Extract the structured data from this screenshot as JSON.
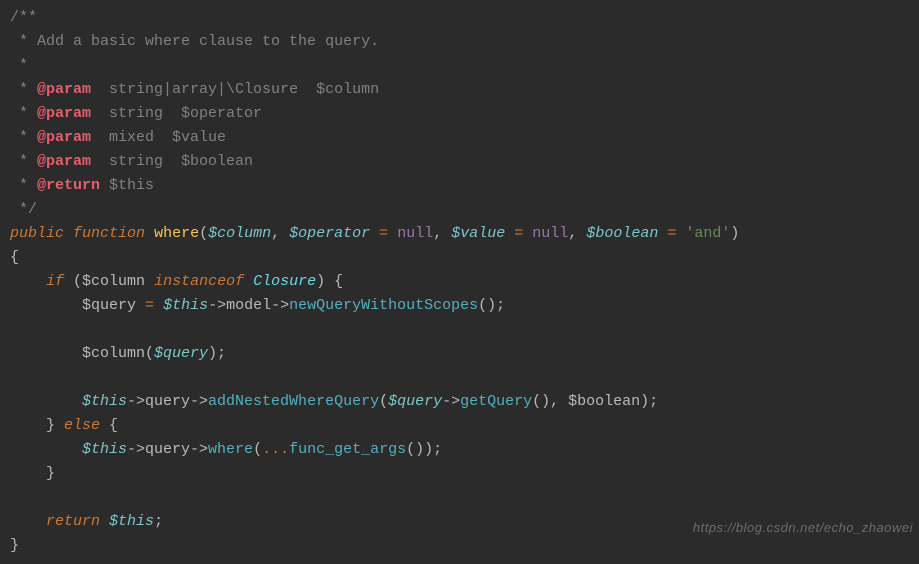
{
  "code": {
    "l1": {
      "a": "/**"
    },
    "l2": {
      "a": " * ",
      "b": "Add a basic where clause to the query."
    },
    "l3": {
      "a": " *"
    },
    "l4": {
      "a": " * ",
      "b": "@param",
      "c": "  string|array|\\Closure  $column"
    },
    "l5": {
      "a": " * ",
      "b": "@param",
      "c": "  string  $operator"
    },
    "l6": {
      "a": " * ",
      "b": "@param",
      "c": "  mixed  $value"
    },
    "l7": {
      "a": " * ",
      "b": "@param",
      "c": "  string  $boolean"
    },
    "l8": {
      "a": " * ",
      "b": "@return",
      "c": " $this"
    },
    "l9": {
      "a": " */"
    },
    "l10": {
      "a": "public",
      "b": " ",
      "c": "function",
      "d": " ",
      "e": "where",
      "f": "(",
      "g": "$column",
      "h": ", ",
      "i": "$operator",
      "j": " ",
      "k": "=",
      "l": " ",
      "m": "null",
      "n": ", ",
      "o": "$value",
      "p": " ",
      "q": "=",
      "r": " ",
      "s": "null",
      "t": ", ",
      "u": "$boolean",
      "v": " ",
      "w": "=",
      "x": " ",
      "y": "'and'",
      "z": ")"
    },
    "l11": {
      "a": "{"
    },
    "l12": {
      "a": "    ",
      "b": "if",
      "c": " (",
      "d": "$column",
      "e": " ",
      "f": "instanceof",
      "g": " ",
      "h": "Closure",
      "i": ") {"
    },
    "l13": {
      "a": "        $query ",
      "b": "=",
      "c": " ",
      "d": "$this",
      "e": "->model->",
      "f": "newQueryWithoutScopes",
      "g": "();"
    },
    "l14": {
      "a": ""
    },
    "l15": {
      "a": "        $column(",
      "b": "$query",
      "c": ");"
    },
    "l16": {
      "a": ""
    },
    "l17": {
      "a": "        ",
      "b": "$this",
      "c": "->query->",
      "d": "addNestedWhereQuery",
      "e": "(",
      "f": "$query",
      "g": "->",
      "h": "getQuery",
      "i": "(), $boolean);"
    },
    "l18": {
      "a": "    } ",
      "b": "else",
      "c": " {"
    },
    "l19": {
      "a": "        ",
      "b": "$this",
      "c": "->query->",
      "d": "where",
      "e": "(",
      "f": "...",
      "g": "func_get_args",
      "h": "());"
    },
    "l20": {
      "a": "    }"
    },
    "l21": {
      "a": ""
    },
    "l22": {
      "a": "    ",
      "b": "return",
      "c": " ",
      "d": "$this",
      "e": ";"
    },
    "l23": {
      "a": "}"
    }
  },
  "watermark": "https://blog.csdn.net/echo_zhaowei"
}
